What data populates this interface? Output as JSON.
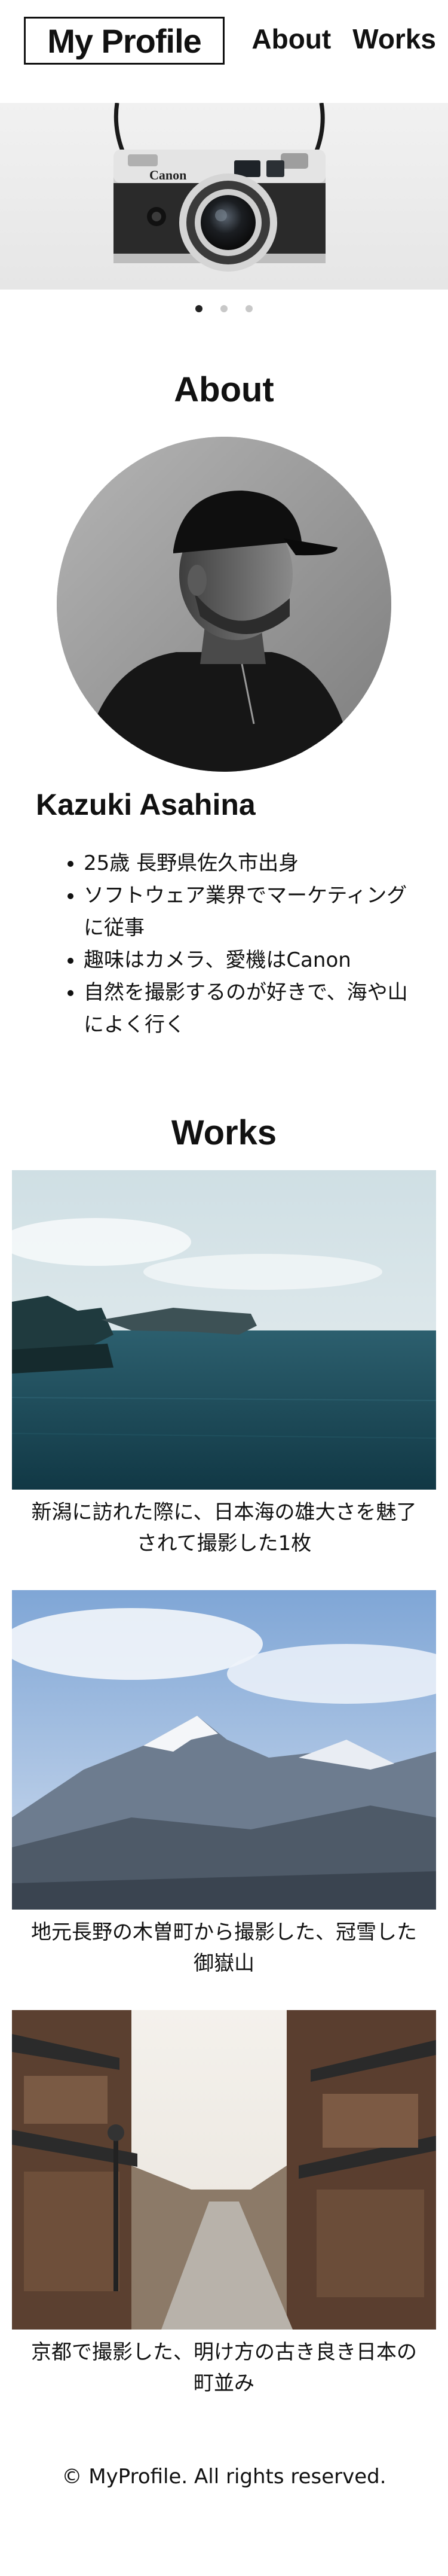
{
  "header": {
    "logo": "My Profile",
    "nav": [
      "About",
      "Works"
    ]
  },
  "hero": {
    "camera_brand": "Canon",
    "slides": 3,
    "active_slide": 1
  },
  "about": {
    "title": "About",
    "name": "Kazuki Asahina",
    "bio": [
      "25歳 長野県佐久市出身",
      "ソフトウェア業界でマーケティングに従事",
      "趣味はカメラ、愛機はCanon",
      "自然を撮影するのが好きで、海や山によく行く"
    ]
  },
  "works": {
    "title": "Works",
    "items": [
      {
        "caption": "新潟に訪れた際に、日本海の雄大さを魅了されて撮影した1枚"
      },
      {
        "caption": "地元長野の木曽町から撮影した、冠雪した御嶽山"
      },
      {
        "caption": "京都で撮影した、明け方の古き良き日本の町並み"
      }
    ]
  },
  "footer": {
    "copyright": "© MyProfile. All rights reserved."
  }
}
